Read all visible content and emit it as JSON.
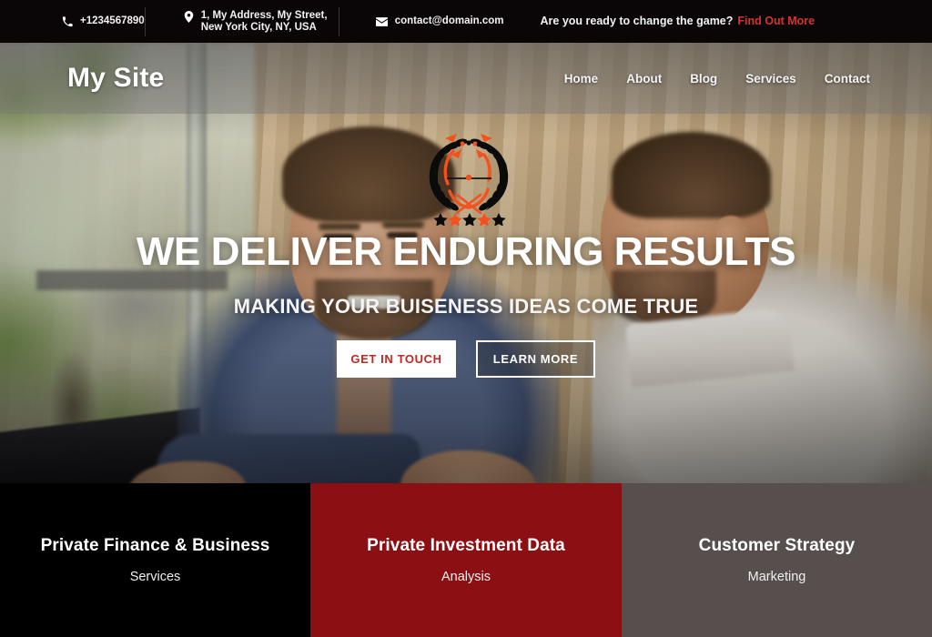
{
  "topbar": {
    "phone": "+1234567890",
    "address": "1, My Address, My Street, New York City, NY, USA",
    "email": "contact@domain.com",
    "cta_text": "Are you ready to change the game?",
    "cta_link": "Find Out More",
    "cta_link_color": "#d8342b",
    "background": "#0a0607"
  },
  "nav": {
    "brand": "My Site",
    "links": [
      {
        "label": "Home"
      },
      {
        "label": "About"
      },
      {
        "label": "Blog"
      },
      {
        "label": "Services"
      },
      {
        "label": "Contact"
      }
    ]
  },
  "emblem": {
    "name": "laurel-wreath-badge",
    "accent_color": "#f4511e",
    "wreath_color": "#0d0d0d",
    "stars": 5
  },
  "hero": {
    "title": "WE DELIVER  ENDURING RESULTS",
    "subtitle": "MAKING YOUR BUISENESS  IDEAS COME TRUE",
    "primary_button": "GET IN TOUCH",
    "secondary_button": "LEARN MORE",
    "primary_button_text_color": "#c22620"
  },
  "panels": [
    {
      "title": "Private Finance & Business",
      "subtitle": "Services",
      "bg": "#000000"
    },
    {
      "title": "Private Investment Data",
      "subtitle": "Analysis",
      "bg": "#8c0f14"
    },
    {
      "title": "Customer Strategy",
      "subtitle": "Marketing",
      "bg": "#574e4e"
    }
  ]
}
